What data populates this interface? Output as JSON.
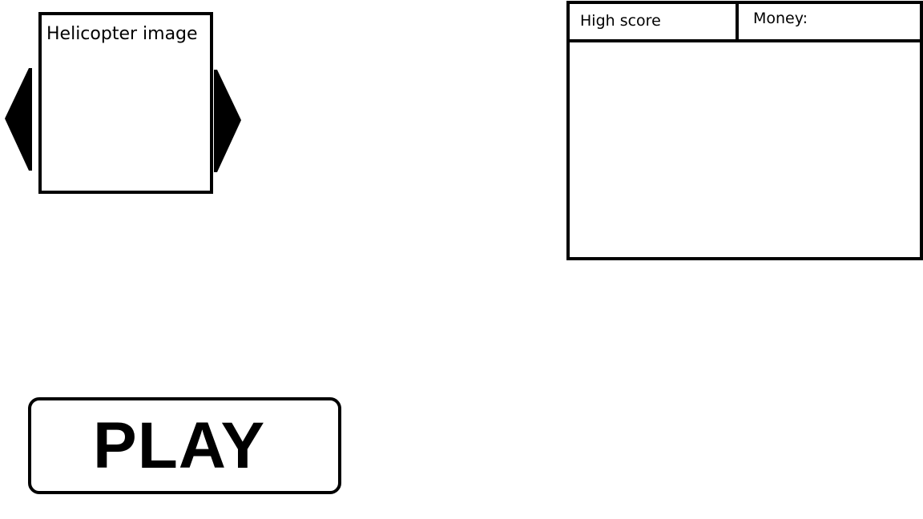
{
  "helicopter_selector": {
    "image_label": "Helicopter image",
    "prev_icon": "triangle-left-icon",
    "next_icon": "triangle-right-icon"
  },
  "stats": {
    "high_score_label": "High score",
    "money_label": "Money:"
  },
  "play_button": {
    "label": "PLAY"
  }
}
